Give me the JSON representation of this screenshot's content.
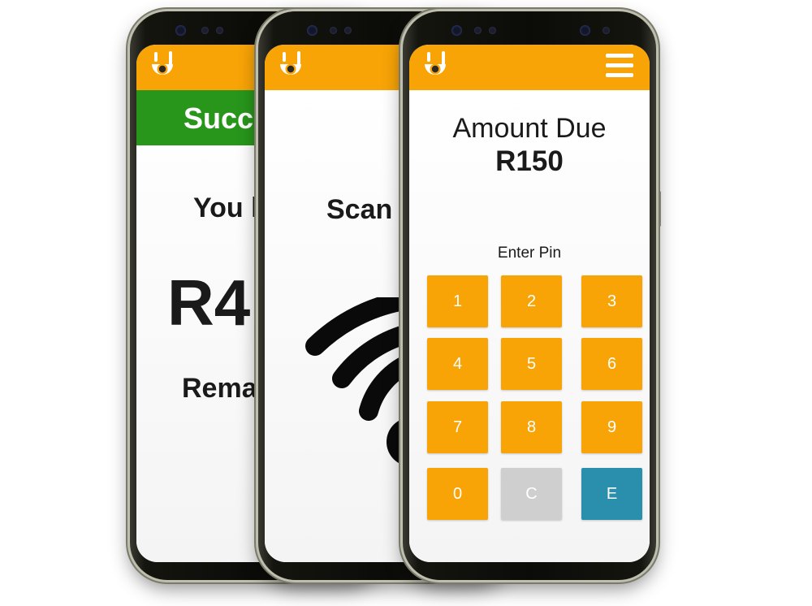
{
  "brand": {
    "logo": "id-logo",
    "accent": "#f8a407",
    "success": "#27961b",
    "enter_key": "#2a8fad",
    "clear_key": "#cfcfcf"
  },
  "phone1": {
    "banner": "Succe",
    "line1": "You l",
    "amount": "R4",
    "line2": "Rema"
  },
  "phone2": {
    "title": "Scan",
    "icon": "wifi-icon"
  },
  "phone3": {
    "amount_label": "Amount Due",
    "amount": "R150",
    "pin_label": "Enter Pin",
    "menu_icon": "hamburger-icon",
    "keys": [
      "1",
      "2",
      "3",
      "4",
      "5",
      "6",
      "7",
      "8",
      "9",
      "0",
      "C",
      "E"
    ]
  }
}
